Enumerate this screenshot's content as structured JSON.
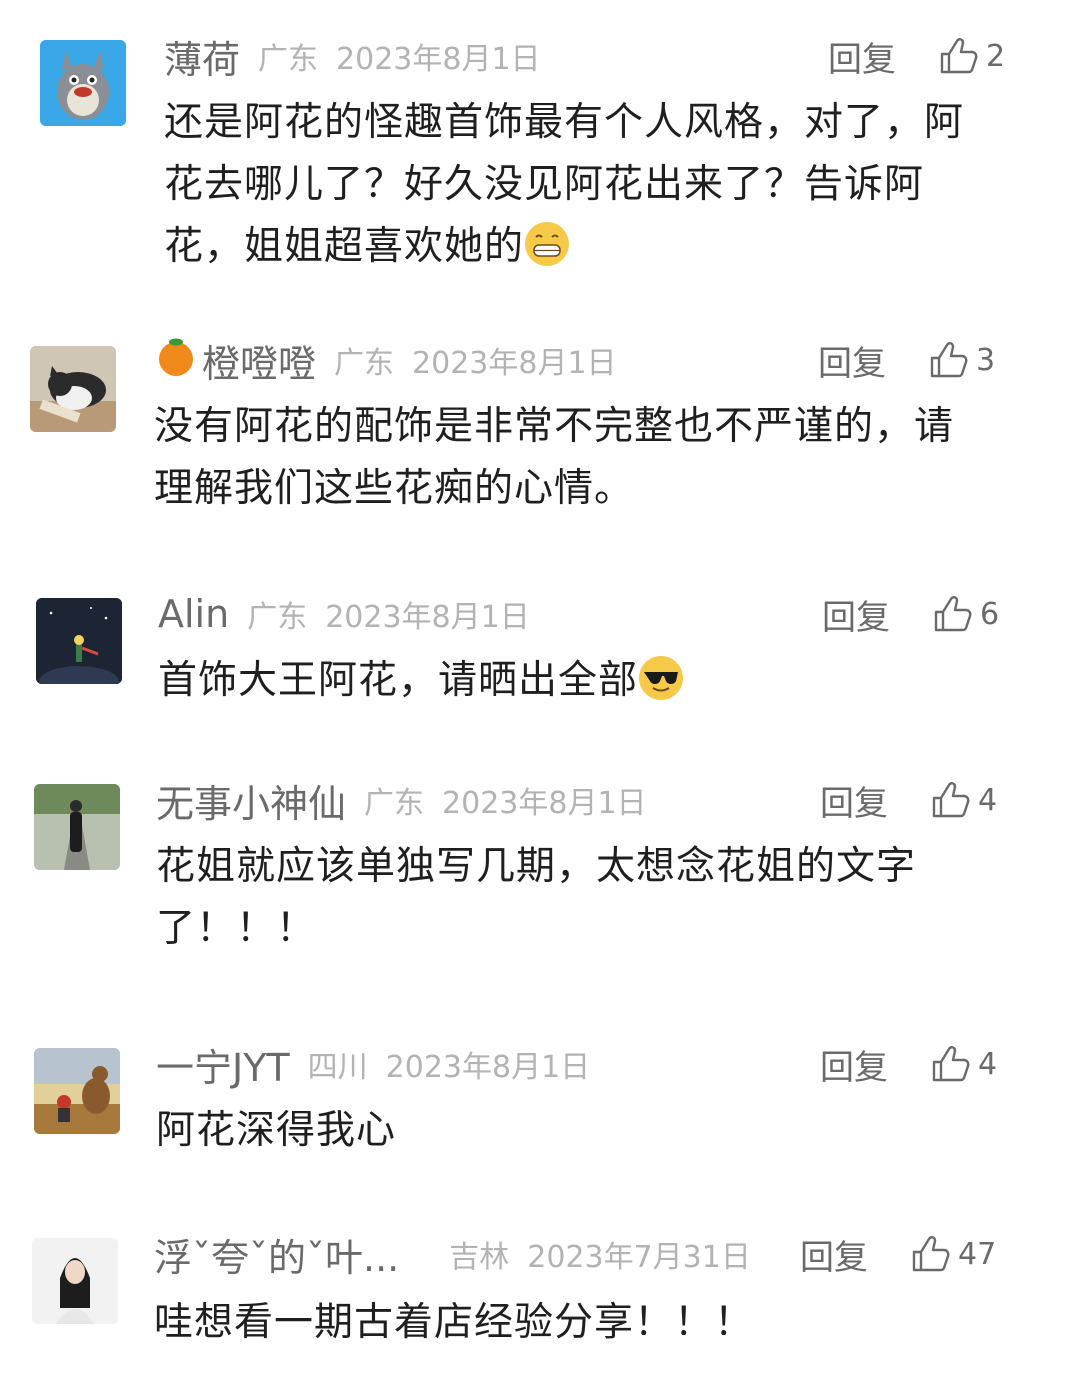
{
  "comments": [
    {
      "username": "薄荷",
      "location": "广东",
      "date": "2023年8月1日",
      "reply_label": "回复",
      "likes": "2",
      "avatar": "totoro-avatar",
      "lines": [
        "还是阿花的怪趣首饰最有个人风格，对了，阿",
        "花去哪儿了？好久没见阿花出来了？告诉阿",
        "花，姐姐超喜欢她的"
      ],
      "emoji": "grinning-face-emoji"
    },
    {
      "username": "橙噔噔",
      "location": "广东",
      "date": "2023年8月1日",
      "reply_label": "回复",
      "likes": "3",
      "avatar": "cat-avatar",
      "username_prefix_icon": "orange-icon",
      "lines": [
        "没有阿花的配饰是非常不完整也不严谨的，请",
        "理解我们这些花痴的心情。"
      ]
    },
    {
      "username": "Alin",
      "location": "广东",
      "date": "2023年8月1日",
      "reply_label": "回复",
      "likes": "6",
      "avatar": "little-prince-avatar",
      "lines": [
        "首饰大王阿花，请晒出全部"
      ],
      "emoji": "sunglasses-face-emoji"
    },
    {
      "username": "无事小神仙",
      "location": "广东",
      "date": "2023年8月1日",
      "reply_label": "回复",
      "likes": "4",
      "avatar": "woman-road-avatar",
      "lines": [
        "花姐就应该单独写几期，太想念花姐的文字",
        "了！！！"
      ]
    },
    {
      "username": "一宁JYT",
      "location": "四川",
      "date": "2023年8月1日",
      "reply_label": "回复",
      "likes": "4",
      "avatar": "camel-desert-avatar",
      "lines": [
        "阿花深得我心"
      ]
    },
    {
      "username": "浮ˇ夸ˇ的ˇ叶...",
      "location": "吉林",
      "date": "2023年7月31日",
      "reply_label": "回复",
      "likes": "47",
      "avatar": "woman-portrait-avatar",
      "lines": [
        "哇想看一期古着店经验分享！！！"
      ]
    }
  ],
  "colors": {
    "username": "#6a6a6a",
    "meta": "#b3b3b3",
    "text": "#1f1f1f"
  }
}
